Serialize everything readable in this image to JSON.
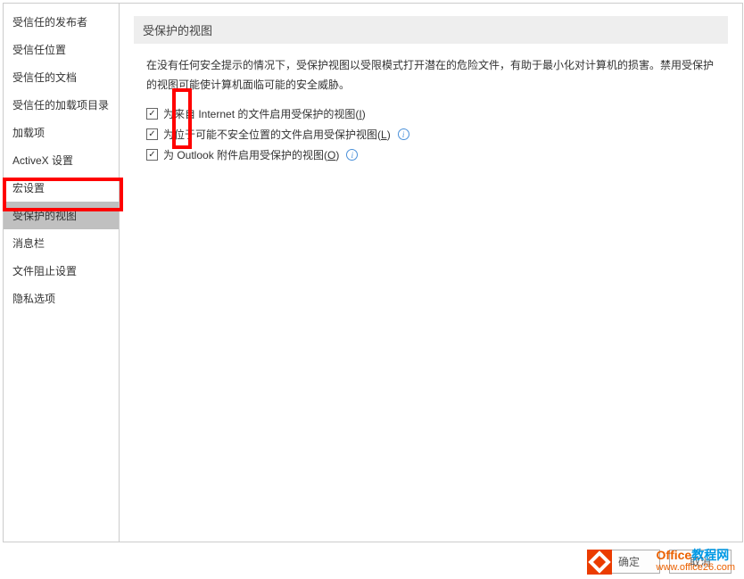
{
  "sidebar": {
    "items": [
      {
        "label": "受信任的发布者"
      },
      {
        "label": "受信任位置"
      },
      {
        "label": "受信任的文档"
      },
      {
        "label": "受信任的加载项目录"
      },
      {
        "label": "加载项"
      },
      {
        "label": "ActiveX 设置"
      },
      {
        "label": "宏设置"
      },
      {
        "label": "受保护的视图"
      },
      {
        "label": "消息栏"
      },
      {
        "label": "文件阻止设置"
      },
      {
        "label": "隐私选项"
      }
    ],
    "selected_index": 7
  },
  "content": {
    "section_title": "受保护的视图",
    "description": "在没有任何安全提示的情况下，受保护视图以受限模式打开潜在的危险文件，有助于最小化对计算机的损害。禁用受保护的视图可能使计算机面临可能的安全威胁。",
    "options": [
      {
        "label_pre": "为来自 Internet 的文件启用受保护的视图(",
        "mnemonic": "I",
        "label_post": ")",
        "checked": true,
        "info": false
      },
      {
        "label_pre": "为位于可能不安全位置的文件启用受保护视图(",
        "mnemonic": "L",
        "label_post": ")",
        "checked": true,
        "info": true
      },
      {
        "label_pre": "为 Outlook 附件启用受保护的视图(",
        "mnemonic": "O",
        "label_post": ")",
        "checked": true,
        "info": true
      }
    ]
  },
  "footer": {
    "ok": "确定",
    "cancel": "取消"
  },
  "watermark": {
    "line1a": "Office",
    "line1b": "教程网",
    "line2": "www.office26.com"
  }
}
